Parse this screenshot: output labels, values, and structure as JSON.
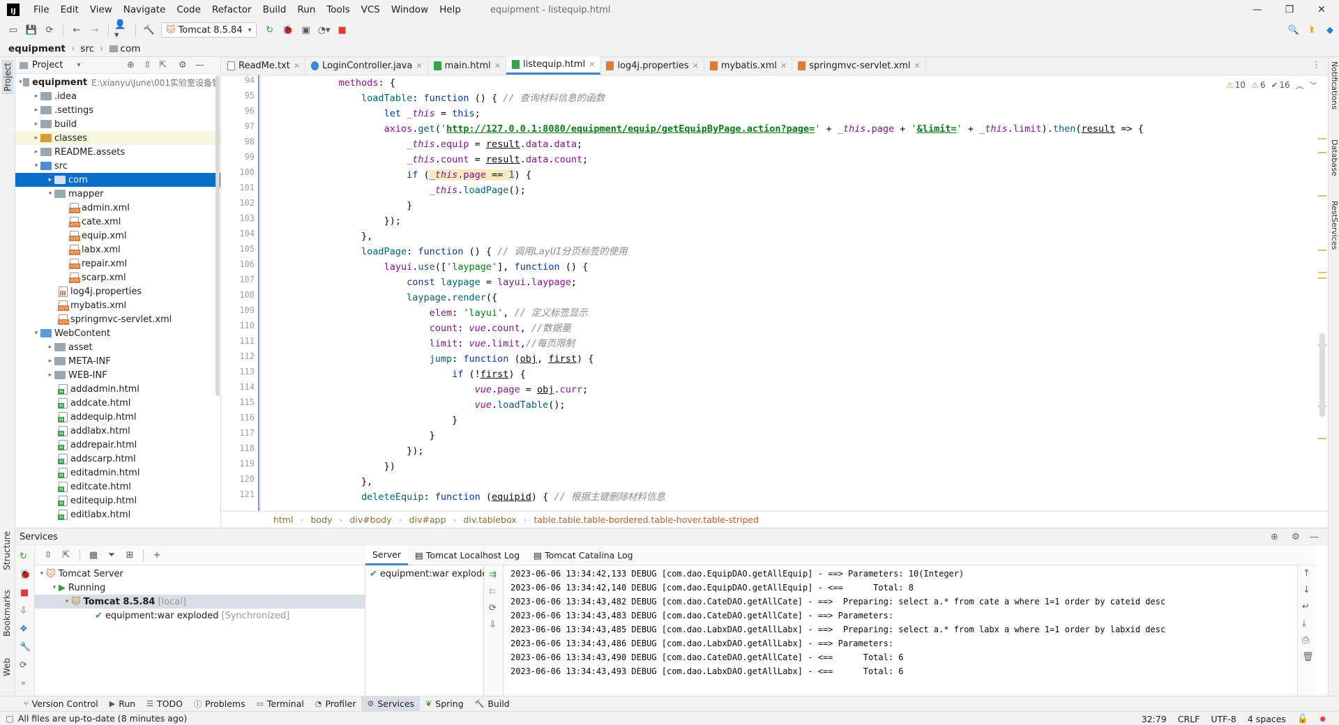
{
  "window": {
    "title": "equipment - listequip.html",
    "menu": [
      "File",
      "Edit",
      "View",
      "Navigate",
      "Code",
      "Refactor",
      "Build",
      "Run",
      "Tools",
      "VCS",
      "Window",
      "Help"
    ]
  },
  "toolbar": {
    "run_config": "Tomcat 8.5.84"
  },
  "navbar": {
    "crumbs": [
      "equipment",
      "src",
      "com"
    ]
  },
  "left_stripe": {
    "top": "Project",
    "structure": "Structure",
    "bookmarks": "Bookmarks",
    "web": "Web"
  },
  "right_stripe": {
    "notifications": "Notifications",
    "database": "Database",
    "rest": "RestServices"
  },
  "project": {
    "header": "Project",
    "root_name": "equipment",
    "root_path": "E:\\xianyu\\June\\001实验室设备管",
    "tree": [
      {
        "label": "equipment",
        "depth": 0
      },
      {
        "label": ".idea",
        "depth": 1
      },
      {
        "label": ".settings",
        "depth": 1
      },
      {
        "label": "build",
        "depth": 1
      },
      {
        "label": "classes",
        "depth": 1
      },
      {
        "label": "README.assets",
        "depth": 1
      },
      {
        "label": "src",
        "depth": 1
      },
      {
        "label": "com",
        "depth": 2
      },
      {
        "label": "mapper",
        "depth": 2
      },
      {
        "label": "admin.xml",
        "depth": 3
      },
      {
        "label": "cate.xml",
        "depth": 3
      },
      {
        "label": "equip.xml",
        "depth": 3
      },
      {
        "label": "labx.xml",
        "depth": 3
      },
      {
        "label": "repair.xml",
        "depth": 3
      },
      {
        "label": "scarp.xml",
        "depth": 3
      },
      {
        "label": "log4j.properties",
        "depth": 2
      },
      {
        "label": "mybatis.xml",
        "depth": 2
      },
      {
        "label": "springmvc-servlet.xml",
        "depth": 2
      },
      {
        "label": "WebContent",
        "depth": 1
      },
      {
        "label": "asset",
        "depth": 2
      },
      {
        "label": "META-INF",
        "depth": 2
      },
      {
        "label": "WEB-INF",
        "depth": 2
      },
      {
        "label": "addadmin.html",
        "depth": 2
      },
      {
        "label": "addcate.html",
        "depth": 2
      },
      {
        "label": "addequip.html",
        "depth": 2
      },
      {
        "label": "addlabx.html",
        "depth": 2
      },
      {
        "label": "addrepair.html",
        "depth": 2
      },
      {
        "label": "addscarp.html",
        "depth": 2
      },
      {
        "label": "editadmin.html",
        "depth": 2
      },
      {
        "label": "editcate.html",
        "depth": 2
      },
      {
        "label": "editequip.html",
        "depth": 2
      },
      {
        "label": "editlabx.html",
        "depth": 2
      }
    ]
  },
  "editor": {
    "tabs": [
      "ReadMe.txt",
      "LoginController.java",
      "main.html",
      "listequip.html",
      "log4j.properties",
      "mybatis.xml",
      "springmvc-servlet.xml"
    ],
    "active_tab": "listequip.html",
    "inspections": {
      "warnings": "10",
      "weak": "6",
      "ok": "16"
    },
    "line_numbers": [
      "94",
      "95",
      "96",
      "97",
      "98",
      "99",
      "100",
      "101",
      "102",
      "103",
      "104",
      "105",
      "106",
      "107",
      "108",
      "109",
      "110",
      "111",
      "112",
      "113",
      "114",
      "115",
      "116",
      "117",
      "118",
      "119",
      "120",
      "121"
    ],
    "breadcrumbs": [
      "html",
      "body",
      "div#body",
      "div#app",
      "div.tablebox",
      "table.table.table-bordered.table-hover.table-striped"
    ]
  },
  "services": {
    "title": "Services",
    "tree": {
      "server": "Tomcat Server",
      "running": "Running",
      "tomcat": "Tomcat 8.5.84",
      "tomcat_tag": "[local]",
      "artifact": "equipment:war exploded",
      "artifact_tag": "[Synchronized]"
    },
    "log_tabs": [
      "Server",
      "Tomcat Localhost Log",
      "Tomcat Catalina Log"
    ],
    "deployment": "equipment:war exploded",
    "log": [
      "2023-06-06 13:34:42,133 DEBUG [com.dao.EquipDAO.getAllEquip] - ==> Parameters: 10(Integer)",
      "2023-06-06 13:34:42,140 DEBUG [com.dao.EquipDAO.getAllEquip] - <==      Total: 8",
      "2023-06-06 13:34:43,482 DEBUG [com.dao.CateDAO.getAllCate] - ==>  Preparing: select a.* from cate a where 1=1 order by cateid desc",
      "2023-06-06 13:34:43,483 DEBUG [com.dao.CateDAO.getAllCate] - ==> Parameters: ",
      "2023-06-06 13:34:43,485 DEBUG [com.dao.LabxDAO.getAllLabx] - ==>  Preparing: select a.* from labx a where 1=1 order by labxid desc",
      "2023-06-06 13:34:43,486 DEBUG [com.dao.LabxDAO.getAllLabx] - ==> Parameters: ",
      "2023-06-06 13:34:43,490 DEBUG [com.dao.CateDAO.getAllCate] - <==      Total: 6",
      "2023-06-06 13:34:43,493 DEBUG [com.dao.LabxDAO.getAllLabx] - <==      Total: 6"
    ]
  },
  "tool_windows": [
    "Version Control",
    "Run",
    "TODO",
    "Problems",
    "Terminal",
    "Profiler",
    "Services",
    "Spring",
    "Build"
  ],
  "status": {
    "message": "All files are up-to-date (8 minutes ago)",
    "position": "32:79",
    "line_sep": "CRLF",
    "encoding": "UTF-8",
    "indent": "4 spaces"
  }
}
